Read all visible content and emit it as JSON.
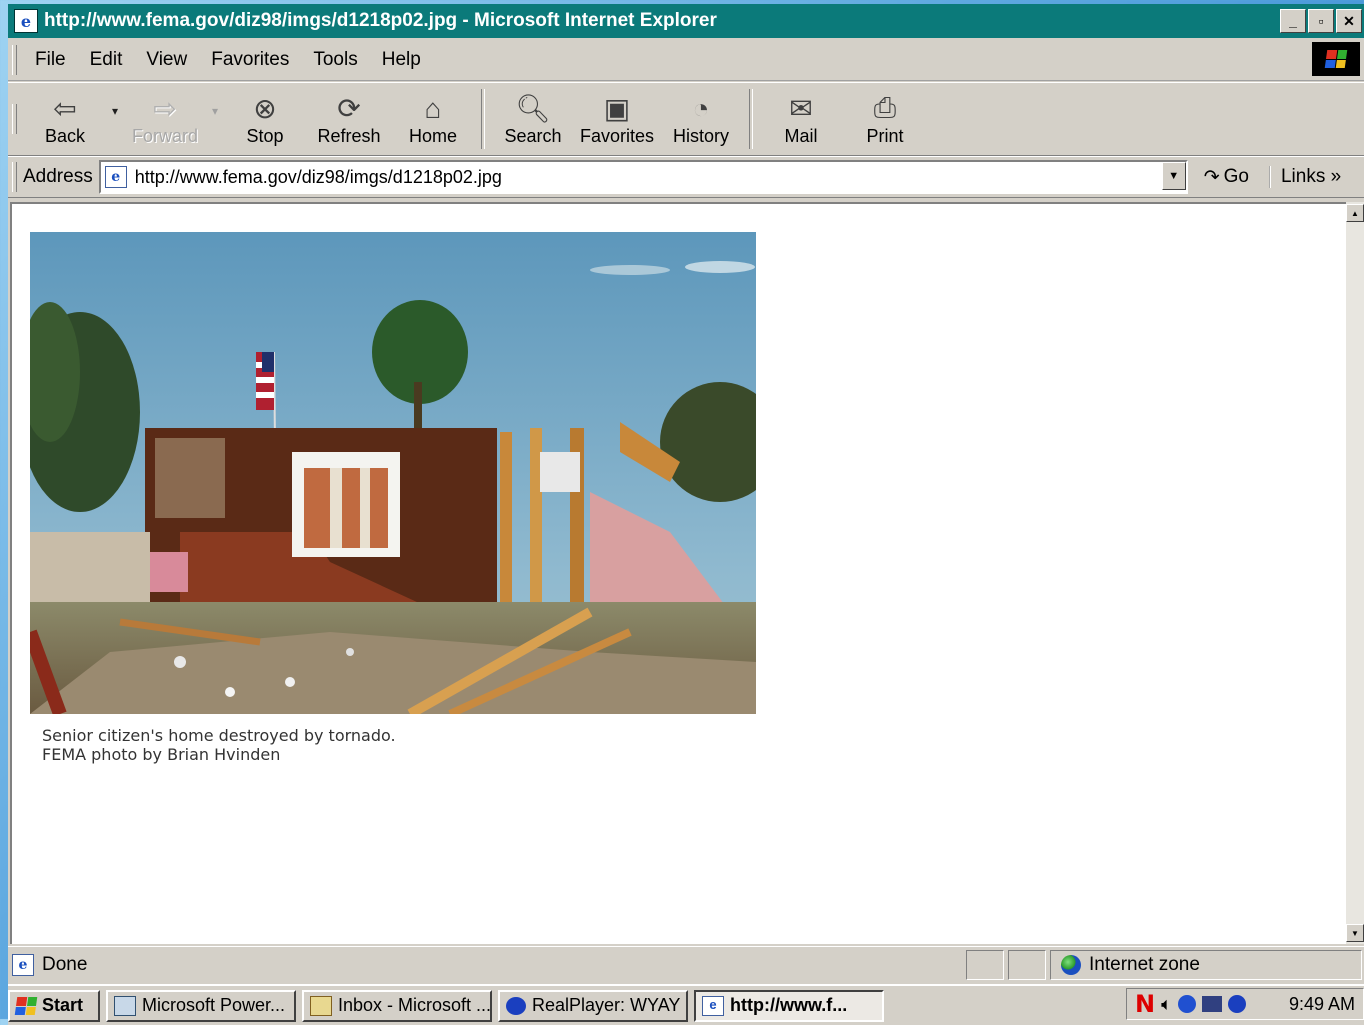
{
  "window": {
    "title": "http://www.fema.gov/diz98/imgs/d1218p02.jpg - Microsoft Internet Explorer",
    "minimize": "_",
    "maximize": "▫",
    "close": "✕"
  },
  "menu": [
    "File",
    "Edit",
    "View",
    "Favorites",
    "Tools",
    "Help"
  ],
  "toolbar": {
    "back": "Back",
    "forward": "Forward",
    "stop": "Stop",
    "refresh": "Refresh",
    "home": "Home",
    "search": "Search",
    "favorites": "Favorites",
    "history": "History",
    "mail": "Mail",
    "print": "Print"
  },
  "address": {
    "label": "Address",
    "value": "http://www.fema.gov/diz98/imgs/d1218p02.jpg",
    "go": "Go",
    "links": "Links »"
  },
  "page": {
    "caption_line1": "Senior citizen's home destroyed by tornado.",
    "caption_line2": "FEMA photo by Brian Hvinden"
  },
  "status": {
    "text": "Done",
    "zone": "Internet zone"
  },
  "taskbar": {
    "start": "Start",
    "tasks": [
      {
        "label": "Microsoft Power..."
      },
      {
        "label": "Inbox - Microsoft ..."
      },
      {
        "label": "RealPlayer: WYAY"
      },
      {
        "label": "http://www.f..."
      }
    ],
    "tray_n": "N",
    "clock": "9:49 AM"
  },
  "colors": {
    "titlebar": "#0b7a7a",
    "chrome": "#d4d0c8"
  }
}
